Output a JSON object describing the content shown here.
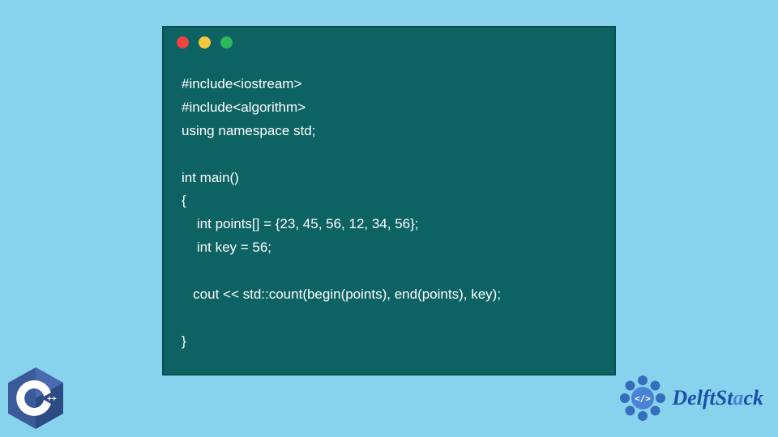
{
  "code": {
    "lines": [
      "#include<iostream>",
      "#include<algorithm>",
      "using namespace std;",
      "",
      "int main()",
      "{",
      "    int points[] = {23, 45, 56, 12, 34, 56};",
      "    int key = 56;",
      "",
      "   cout << std::count(begin(points), end(points), key);",
      "",
      "}"
    ]
  },
  "logos": {
    "cpp_label": "C++",
    "delft_label": "DelftStack"
  }
}
